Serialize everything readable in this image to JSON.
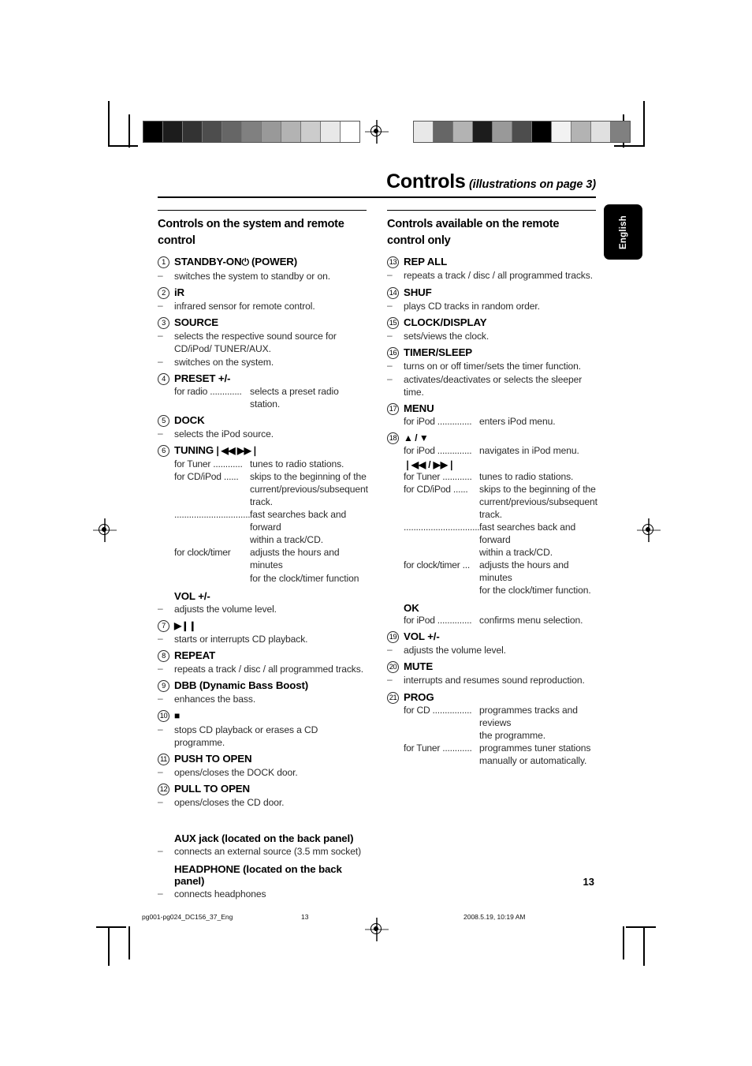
{
  "header": {
    "title": "Controls",
    "subtitle": "(illustrations on page 3)"
  },
  "language_tab": {
    "label": "English"
  },
  "left_column": {
    "heading": "Controls on the system and remote control",
    "entries": [
      {
        "number": "1",
        "label": "STANDBY-ON",
        "glyph": "⏻",
        "label_suffix": "(POWER)",
        "dashes": [
          "switches the system to standby or on."
        ]
      },
      {
        "number": "2",
        "label": "iR",
        "dashes": [
          "infrared sensor for remote control."
        ]
      },
      {
        "number": "3",
        "label": "SOURCE",
        "dashes": [
          "selects the respective sound source for CD/iPod/ TUNER/AUX.",
          "switches on the system."
        ]
      },
      {
        "number": "4",
        "label": "PRESET +/-",
        "leaders": [
          {
            "key": "for radio .............",
            "val": "selects a preset radio station."
          }
        ]
      },
      {
        "number": "5",
        "label": "DOCK",
        "dashes": [
          "selects the iPod source."
        ]
      },
      {
        "number": "6",
        "label": "TUNING",
        "glyph": "❘◀◀  ▶▶❘",
        "leaders": [
          {
            "key": "for Tuner ............",
            "val": "tunes to radio stations."
          },
          {
            "key": "for CD/iPod ......",
            "val": "skips to the beginning of the"
          },
          {
            "key": "",
            "val": "current/previous/subsequent"
          },
          {
            "key": "",
            "val": "track."
          },
          {
            "key": "................................",
            "val": "fast searches back and forward"
          },
          {
            "key": "",
            "val": "within a track/CD."
          },
          {
            "key": "for clock/timer",
            "val": "adjusts the hours and minutes"
          },
          {
            "key": "",
            "val": "for the clock/timer function"
          }
        ]
      },
      {
        "sub_label": "VOL +/-",
        "dashes": [
          "adjusts the volume level."
        ]
      },
      {
        "number": "7",
        "label": "",
        "glyph": "▶❙❙",
        "dashes": [
          "starts or interrupts CD playback."
        ]
      },
      {
        "number": "8",
        "label": "REPEAT",
        "dashes": [
          "repeats a track / disc / all programmed tracks."
        ]
      },
      {
        "number": "9",
        "label": "DBB (Dynamic Bass Boost)",
        "dashes": [
          "enhances the bass."
        ]
      },
      {
        "number": "10",
        "label": "",
        "glyph": "■",
        "dashes": [
          "stops CD playback or erases a CD programme."
        ]
      },
      {
        "number": "11",
        "label": "PUSH TO OPEN",
        "dashes": [
          "opens/closes the DOCK door."
        ]
      },
      {
        "number": "12",
        "label": "PULL TO OPEN",
        "dashes": [
          "opens/closes the CD door."
        ]
      },
      {
        "sub_label": "AUX jack (located on the back panel)",
        "dashes": [
          "connects an external source (3.5 mm socket)"
        ]
      },
      {
        "sub_label": "HEADPHONE (located on the back panel)",
        "dashes": [
          "connects headphones"
        ]
      }
    ]
  },
  "right_column": {
    "heading": "Controls available on the remote control only",
    "entries": [
      {
        "number": "13",
        "label": "REP ALL",
        "dashes": [
          "repeats a track / disc / all programmed tracks."
        ]
      },
      {
        "number": "14",
        "label": "SHUF",
        "dashes": [
          "plays CD tracks in random order."
        ]
      },
      {
        "number": "15",
        "label": "CLOCK/DISPLAY",
        "dashes": [
          "sets/views the clock."
        ]
      },
      {
        "number": "16",
        "label": "TIMER/SLEEP",
        "dashes": [
          "turns on or off timer/sets the timer function.",
          "activates/deactivates or selects the sleeper time."
        ]
      },
      {
        "number": "17",
        "label": "MENU",
        "leaders": [
          {
            "key": "for iPod ..............",
            "val": "enters iPod menu."
          }
        ]
      },
      {
        "number": "18",
        "label": "",
        "glyph": "▲ / ▼",
        "leaders": [
          {
            "key": "for iPod ..............",
            "val": "navigates in iPod menu."
          }
        ],
        "glyph2": "❘◀◀ / ▶▶❘",
        "leaders2": [
          {
            "key": "for Tuner ............",
            "val": "tunes to radio stations."
          },
          {
            "key": "for CD/iPod ......",
            "val": "skips to the beginning of the"
          },
          {
            "key": "",
            "val": "current/previous/subsequent"
          },
          {
            "key": "",
            "val": "track."
          },
          {
            "key": "................................",
            "val": "fast searches back and forward"
          },
          {
            "key": "",
            "val": "within a track/CD."
          },
          {
            "key": "for clock/timer ...",
            "val": "adjusts the hours and minutes"
          },
          {
            "key": "",
            "val": "for the clock/timer function."
          }
        ]
      },
      {
        "sub_label": "OK",
        "leaders": [
          {
            "key": "for iPod ..............",
            "val": "confirms menu selection."
          }
        ]
      },
      {
        "number": "19",
        "label": "VOL +/-",
        "dashes": [
          "adjusts the volume level."
        ]
      },
      {
        "number": "20",
        "label": "MUTE",
        "dashes": [
          "interrupts and resumes sound reproduction."
        ]
      },
      {
        "number": "21",
        "label": "PROG",
        "leaders": [
          {
            "key": "for CD ................",
            "val": "programmes tracks and reviews"
          },
          {
            "key": "",
            "val": "the programme."
          },
          {
            "key": "for Tuner ............",
            "val": "programmes tuner stations"
          },
          {
            "key": "",
            "val": "manually or automatically."
          }
        ]
      }
    ]
  },
  "page_number": "13",
  "footer": {
    "file_name": "pg001-pg024_DC156_37_Eng",
    "page": "13",
    "timestamp": "2008.5.19, 10:19 AM"
  },
  "gray_bars": {
    "left_steps": [
      "#000000",
      "#1c1c1c",
      "#333333",
      "#4d4d4d",
      "#666666",
      "#808080",
      "#999999",
      "#b3b3b3",
      "#cccccc",
      "#e8e8e8",
      "#ffffff"
    ],
    "right_steps": [
      "#e8e8e8",
      "#666666",
      "#b3b3b3",
      "#1c1c1c",
      "#999999",
      "#4d4d4d",
      "#000000",
      "#f2f2f2",
      "#b3b3b3",
      "#e0e0e0",
      "#808080"
    ]
  }
}
